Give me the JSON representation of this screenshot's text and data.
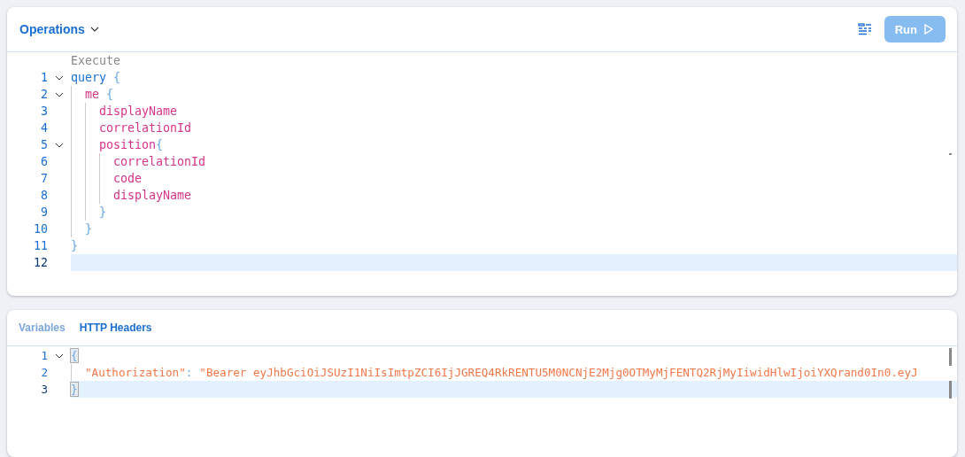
{
  "operations": {
    "title": "Operations",
    "run_button": "Run",
    "codelens": "Execute",
    "lines": [
      {
        "number": "1",
        "tokens": [
          {
            "kind": "keyword",
            "text": "query"
          },
          {
            "kind": "punct",
            "text": "{"
          }
        ],
        "expanded": true,
        "children": [
          {
            "number": "2",
            "tokens": [
              {
                "kind": "field",
                "text": "me"
              },
              {
                "kind": "punct",
                "text": "{"
              }
            ],
            "expanded": true,
            "children": [
              {
                "number": "3",
                "tokens": [
                  {
                    "kind": "field",
                    "text": "displayName"
                  }
                ]
              },
              {
                "number": "4",
                "tokens": [
                  {
                    "kind": "field",
                    "text": "correlationId"
                  }
                ]
              },
              {
                "number": "5",
                "tokens": [
                  {
                    "kind": "field",
                    "text": "position"
                  },
                  {
                    "kind": "punct",
                    "text": "{"
                  }
                ],
                "expanded": true,
                "children": [
                  {
                    "number": "6",
                    "tokens": [
                      {
                        "kind": "field",
                        "text": "correlationId"
                      }
                    ]
                  },
                  {
                    "number": "7",
                    "tokens": [
                      {
                        "kind": "field",
                        "text": "code"
                      }
                    ]
                  },
                  {
                    "number": "8",
                    "tokens": [
                      {
                        "kind": "field",
                        "text": "displayName"
                      }
                    ]
                  }
                ],
                "close": {
                  "number": "9",
                  "tokens": [
                    {
                      "kind": "punct",
                      "text": "}"
                    }
                  ]
                }
              }
            ],
            "close": {
              "number": "10",
              "tokens": [
                {
                  "kind": "punct",
                  "text": "}"
                }
              ]
            }
          }
        ],
        "close": {
          "number": "11",
          "tokens": [
            {
              "kind": "punct",
              "text": "}"
            }
          ]
        }
      },
      {
        "number": "12",
        "selected": true
      }
    ]
  },
  "bottom": {
    "tabs": [
      {
        "label": "Variables",
        "selected": false
      },
      {
        "label": "HTTP Headers",
        "selected": true
      }
    ],
    "lines": [
      {
        "number": "1",
        "tokens": [
          {
            "kind": "bracket",
            "text": "{"
          }
        ],
        "expanded": true,
        "children": [
          {
            "number": "2",
            "tokens": [
              {
                "kind": "string",
                "text": "\"Authorization\""
              },
              {
                "kind": "colon",
                "text": ":"
              },
              {
                "kind": "string",
                "text": "\"Bearer eyJhbGciOiJSUzI1NiIsImtpZCI6IjJGREQ4RkRENTU5M0NCNjE2Mjg0OTMyMjFENTQ2RjMyIiwidHlwIjoiYXQrand0In0.eyJ"
              }
            ]
          }
        ],
        "close": {
          "number": "3",
          "tokens": [
            {
              "kind": "bracket",
              "text": "}"
            }
          ],
          "selected": true
        }
      }
    ]
  }
}
